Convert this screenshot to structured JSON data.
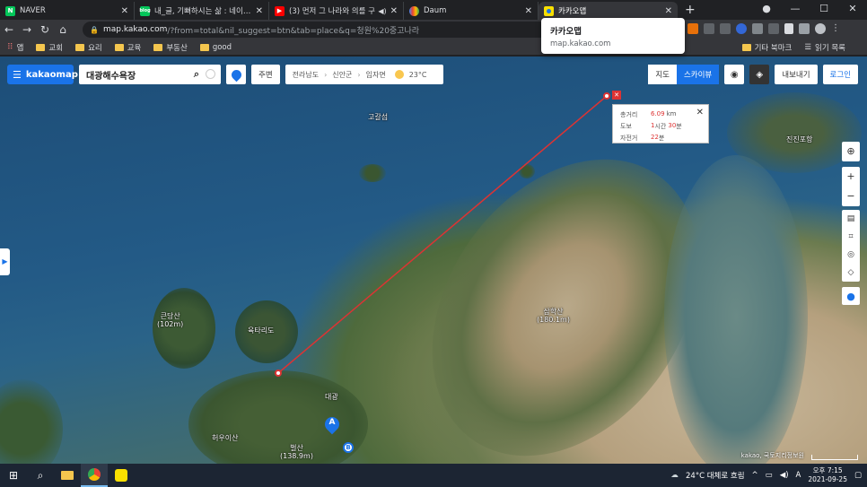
{
  "browser": {
    "tabs": [
      {
        "title": "NAVER",
        "favicon_color": "#03c75a",
        "favicon_glyph": "N"
      },
      {
        "title": "내_글, 기뻐하시는 삶 : 네이버 블",
        "favicon_color": "#03c75a",
        "favicon_glyph": "blog"
      },
      {
        "title": "(3) 먼저 그 나라와 의를 구",
        "favicon_color": "#ff0000",
        "favicon_glyph": "▶"
      },
      {
        "title": "Daum",
        "favicon_color": "#4285f4",
        "favicon_glyph": "●"
      },
      {
        "title": "카카오맵",
        "favicon_color": "#f9e000",
        "favicon_glyph": "◆"
      }
    ],
    "url_host": "map.kakao.com",
    "url_rest": "/?from=total&nil_suggest=btn&tab=place&q=청원%20중고나라",
    "popup": {
      "title": "카카오맵",
      "url": "map.kakao.com"
    },
    "bookmarks": [
      {
        "label": "앱",
        "type": "apps"
      },
      {
        "label": "교회",
        "type": "folder"
      },
      {
        "label": "요리",
        "type": "folder"
      },
      {
        "label": "교육",
        "type": "folder"
      },
      {
        "label": "부동산",
        "type": "folder"
      },
      {
        "label": "good",
        "type": "folder"
      }
    ],
    "bookmarks_other": "기타 북마크",
    "reading_list": "읽기 목록"
  },
  "kakaomap": {
    "logo": "kakaomap",
    "search_value": "대광해수욕장",
    "nearby_label": "주변",
    "breadcrumb": [
      "전라남도",
      "신안군",
      "임자면"
    ],
    "weather": "23°C",
    "view_modes": [
      "지도",
      "스카이뷰"
    ],
    "active_view": "스카이뷰",
    "export_label": "내보내기",
    "login_label": "로그인",
    "distance_info": {
      "total_label": "총거리",
      "total_value": "6.09",
      "total_unit": "km",
      "walk_label": "도보",
      "walk_value_h": "1",
      "walk_unit_h": "시간",
      "walk_value_m": "30",
      "walk_unit_m": "분",
      "bike_label": "자전거",
      "bike_value": "22",
      "bike_unit": "분"
    },
    "place_labels": [
      {
        "text": "고갈섬"
      },
      {
        "text": "큰당산\n(102m)"
      },
      {
        "text": "육타리도"
      },
      {
        "text": "삼학산\n(180.1m)"
      },
      {
        "text": "대광"
      },
      {
        "text": "벌산\n(138.9m)"
      },
      {
        "text": "허우이산"
      },
      {
        "text": "진진포항"
      }
    ],
    "marker_a": "A",
    "marker_b": "B",
    "copyright": "kakao, 국토지리정보원"
  },
  "taskbar": {
    "weather": "24°C 대체로 흐림",
    "time": "오후 7:15",
    "date": "2021-09-25"
  }
}
